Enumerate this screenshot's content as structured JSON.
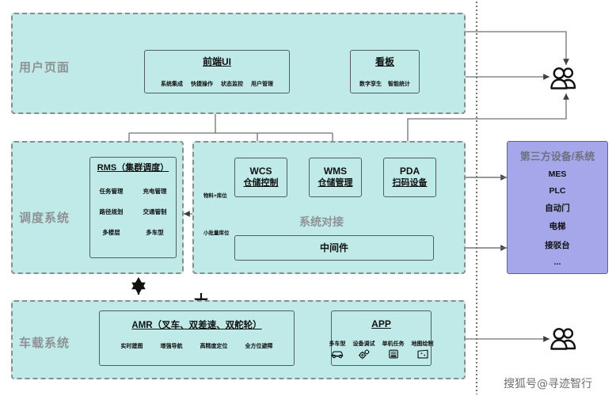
{
  "diagram": {
    "watermark": "搜狐号@寻迹智行",
    "zones": [
      {
        "name": "user-page",
        "title": "用户页面"
      },
      {
        "name": "scheduling-system",
        "title": "调度系统"
      },
      {
        "name": "vehicle-system",
        "title": "车载系统"
      }
    ],
    "inner_caption": "系统对接",
    "boxes": {
      "frontend_ui": {
        "title": "前端UI",
        "items": [
          "系统集成",
          "快捷操作",
          "状态监控",
          "用户管理"
        ]
      },
      "kanban": {
        "title": "看板",
        "items": [
          "数字孪生",
          "智能统计"
        ]
      },
      "rms": {
        "title": "RMS（集群调度）",
        "items": [
          "任务管理",
          "充电管理",
          "路径规划",
          "交通管制",
          "多楼层",
          "多车型"
        ]
      },
      "wcs": {
        "line1": "WCS",
        "line2": "仓储控制"
      },
      "wms": {
        "line1": "WMS",
        "line2": "仓储管理"
      },
      "pda": {
        "line1": "PDA",
        "line2": "扫码设备"
      },
      "middleware": {
        "title": "中间件"
      },
      "amr": {
        "title": "AMR（叉车、双差速、双舵轮）",
        "items": [
          "实时建图",
          "增强导航",
          "高精度定位",
          "全方位避障"
        ]
      },
      "app": {
        "title": "APP",
        "items": [
          {
            "label": "多车型",
            "icon": "car-icon"
          },
          {
            "label": "设备调试",
            "icon": "gears-icon"
          },
          {
            "label": "单机任务",
            "icon": "task-document-icon"
          },
          {
            "label": "地图绘制",
            "icon": "map-icon"
          }
        ]
      }
    },
    "third_party": {
      "title": "第三方设备/系统",
      "items": [
        "MES",
        "PLC",
        "自动门",
        "电梯",
        "接驳台",
        "..."
      ]
    },
    "edge_labels": [
      {
        "name": "material-slot-label",
        "text": "物料+库位"
      },
      {
        "name": "small-batch-slot-label",
        "text": "小批量库位"
      }
    ],
    "actors": [
      {
        "name": "users-actor-top",
        "icon": "users-icon"
      },
      {
        "name": "users-actor-bottom",
        "icon": "users-icon"
      }
    ],
    "colors": {
      "zone_fill": "#bfeae8",
      "zone_border": "#8c8c8c",
      "card_border": "#555c60",
      "third_party_fill": "#a5a7ea",
      "third_party_border": "#5b5da8",
      "title_gray": "#8f9294",
      "wire": "#6d7275"
    }
  }
}
